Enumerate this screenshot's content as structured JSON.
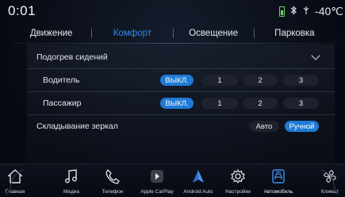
{
  "status": {
    "time": "0:01",
    "temperature": "-40℃",
    "icons": [
      "battery-icon",
      "bluetooth-icon",
      "signal-icon"
    ]
  },
  "tabs": [
    {
      "label": "Движение",
      "active": false
    },
    {
      "label": "Комфорт",
      "active": true
    },
    {
      "label": "Освещение",
      "active": false
    },
    {
      "label": "Парковка",
      "active": false
    }
  ],
  "settings": {
    "seat_heating": {
      "title": "Подогрев сидений",
      "driver": {
        "label": "Водитель",
        "options": [
          "ВЫКЛ.",
          "1",
          "2",
          "3"
        ],
        "selected": "ВЫКЛ."
      },
      "passenger": {
        "label": "Пассажир",
        "options": [
          "ВЫКЛ.",
          "1",
          "2",
          "3"
        ],
        "selected": "ВЫКЛ."
      }
    },
    "mirror_fold": {
      "label": "Складывание зеркал",
      "options": [
        "Авто",
        "Ручной"
      ],
      "selected": "Ручной"
    }
  },
  "dock": [
    {
      "label": "Главная",
      "icon": "home-icon"
    },
    {
      "label": "Медиа",
      "icon": "music-note-icon"
    },
    {
      "label": "Телефон",
      "icon": "phone-icon"
    },
    {
      "label": "Apple CarPlay",
      "icon": "carplay-icon"
    },
    {
      "label": "Android Auto",
      "icon": "android-auto-icon"
    },
    {
      "label": "Настройки",
      "icon": "gear-icon"
    },
    {
      "label": "Автомобиль",
      "icon": "car-settings-icon",
      "active": true
    },
    {
      "label": "Климат",
      "icon": "fan-icon"
    }
  ],
  "colors": {
    "accent": "#1e7ad6",
    "active_tab": "#2f86e6",
    "background": "#070a12"
  }
}
